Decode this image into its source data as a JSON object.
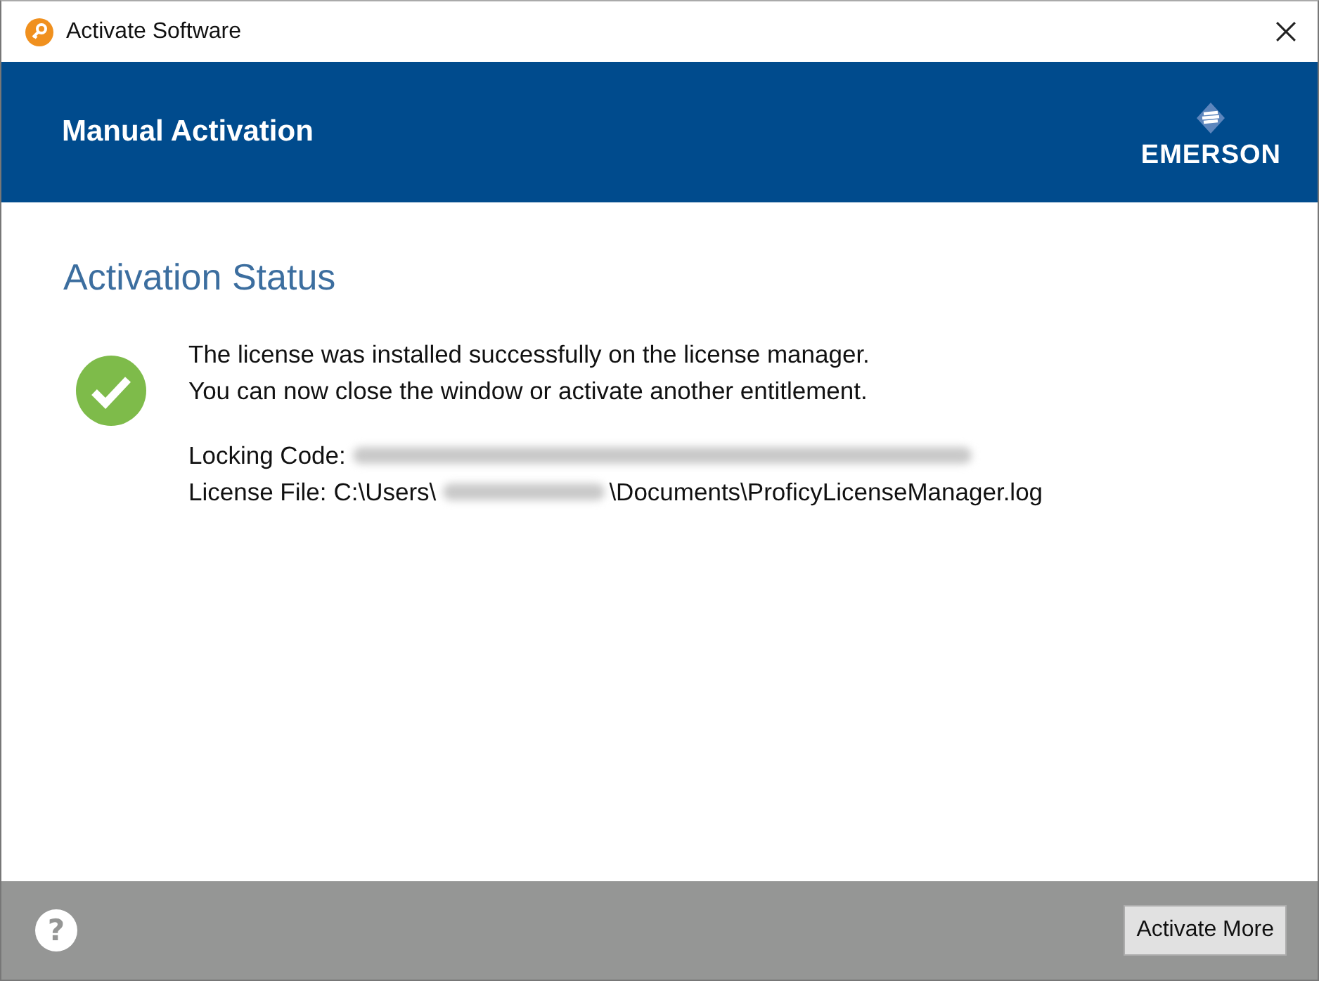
{
  "window": {
    "title": "Activate Software"
  },
  "header": {
    "title": "Manual Activation",
    "logo": "EMERSON"
  },
  "status": {
    "heading": "Activation Status",
    "messages": [
      "The license was installed successfully on the license manager.",
      "You can now close the window or activate another entitlement."
    ],
    "locking_code": {
      "label": "Locking Code:"
    },
    "license_file": {
      "label": "License File:",
      "path_start": "C:\\Users\\",
      "path_end": "\\Documents\\ProficyLicenseManager.log"
    }
  },
  "footer": {
    "help": "?",
    "button": "Activate More"
  }
}
